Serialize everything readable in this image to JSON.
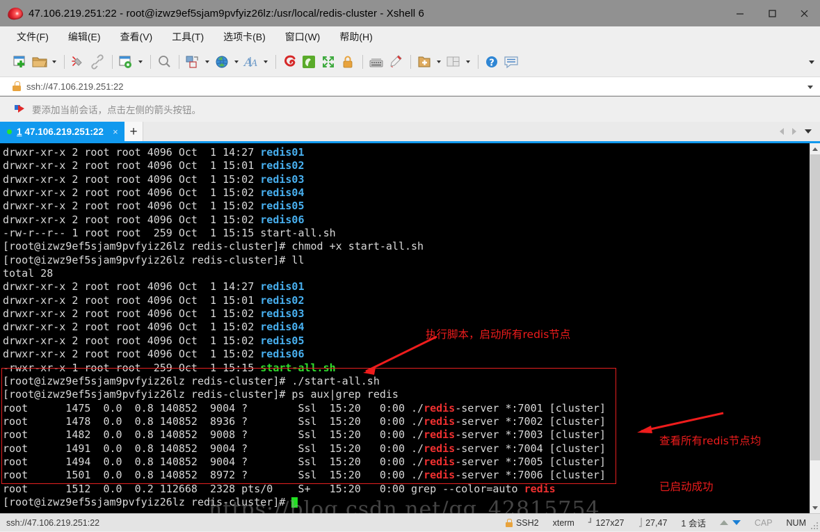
{
  "window": {
    "title": "47.106.219.251:22 - root@izwz9ef5sjam9pvfyiz26lz:/usr/local/redis-cluster - Xshell 6",
    "app_icon": "xshell-shell-icon",
    "minimize": "—",
    "maximize": "□",
    "close": "✕"
  },
  "menubar": {
    "items": [
      {
        "label": "文件(F)",
        "name": "menu-file"
      },
      {
        "label": "编辑(E)",
        "name": "menu-edit"
      },
      {
        "label": "查看(V)",
        "name": "menu-view"
      },
      {
        "label": "工具(T)",
        "name": "menu-tools"
      },
      {
        "label": "选项卡(B)",
        "name": "menu-tabs"
      },
      {
        "label": "窗口(W)",
        "name": "menu-window"
      },
      {
        "label": "帮助(H)",
        "name": "menu-help"
      }
    ]
  },
  "toolbar": {
    "icons": [
      "new-session-icon",
      "open-folder-icon",
      "disconnect-icon",
      "link-icon",
      "session-properties-icon",
      "find-icon",
      "file-transfer-icon",
      "web-transfer-icon",
      "font-icon",
      "xshell-icon",
      "xftp-icon",
      "fullscreen-icon",
      "lock-icon",
      "keyboard-icon",
      "highlight-icon",
      "new-folder-icon",
      "layout-icon",
      "help-icon",
      "feedback-icon"
    ],
    "overflow": "toolbar-overflow-icon"
  },
  "address_bar": {
    "lock_icon": "lock-icon",
    "url": "ssh://47.106.219.251:22",
    "dropdown_icon": "chevron-down-icon"
  },
  "notice": {
    "icon": "red-flag-icon",
    "text": "要添加当前会话，点击左侧的箭头按钮。"
  },
  "tabs": {
    "active": {
      "status_dot": "connected",
      "index": "1",
      "label": "47.106.219.251:22",
      "close_icon": "×"
    },
    "new_tab_label": "+",
    "scroll_left_icon": "chevron-left-icon",
    "scroll_right_icon": "chevron-right-icon",
    "tab_menu_icon": "chevron-down-icon"
  },
  "terminal": {
    "lines": [
      [
        {
          "t": "drwxr-xr-x 2 root root 4096 Oct  1 14:27 ",
          "c": "w"
        },
        {
          "t": "redis01",
          "c": "b"
        }
      ],
      [
        {
          "t": "drwxr-xr-x 2 root root 4096 Oct  1 15:01 ",
          "c": "w"
        },
        {
          "t": "redis02",
          "c": "b"
        }
      ],
      [
        {
          "t": "drwxr-xr-x 2 root root 4096 Oct  1 15:02 ",
          "c": "w"
        },
        {
          "t": "redis03",
          "c": "b"
        }
      ],
      [
        {
          "t": "drwxr-xr-x 2 root root 4096 Oct  1 15:02 ",
          "c": "w"
        },
        {
          "t": "redis04",
          "c": "b"
        }
      ],
      [
        {
          "t": "drwxr-xr-x 2 root root 4096 Oct  1 15:02 ",
          "c": "w"
        },
        {
          "t": "redis05",
          "c": "b"
        }
      ],
      [
        {
          "t": "drwxr-xr-x 2 root root 4096 Oct  1 15:02 ",
          "c": "w"
        },
        {
          "t": "redis06",
          "c": "b"
        }
      ],
      [
        {
          "t": "-rw-r--r-- 1 root root  259 Oct  1 15:15 start-all.sh",
          "c": "w"
        }
      ],
      [
        {
          "t": "[root@izwz9ef5sjam9pvfyiz26lz redis-cluster]# chmod +x start-all.sh",
          "c": "w"
        }
      ],
      [
        {
          "t": "[root@izwz9ef5sjam9pvfyiz26lz redis-cluster]# ll",
          "c": "w"
        }
      ],
      [
        {
          "t": "total 28",
          "c": "w"
        }
      ],
      [
        {
          "t": "drwxr-xr-x 2 root root 4096 Oct  1 14:27 ",
          "c": "w"
        },
        {
          "t": "redis01",
          "c": "b"
        }
      ],
      [
        {
          "t": "drwxr-xr-x 2 root root 4096 Oct  1 15:01 ",
          "c": "w"
        },
        {
          "t": "redis02",
          "c": "b"
        }
      ],
      [
        {
          "t": "drwxr-xr-x 2 root root 4096 Oct  1 15:02 ",
          "c": "w"
        },
        {
          "t": "redis03",
          "c": "b"
        }
      ],
      [
        {
          "t": "drwxr-xr-x 2 root root 4096 Oct  1 15:02 ",
          "c": "w"
        },
        {
          "t": "redis04",
          "c": "b"
        }
      ],
      [
        {
          "t": "drwxr-xr-x 2 root root 4096 Oct  1 15:02 ",
          "c": "w"
        },
        {
          "t": "redis05",
          "c": "b"
        }
      ],
      [
        {
          "t": "drwxr-xr-x 2 root root 4096 Oct  1 15:02 ",
          "c": "w"
        },
        {
          "t": "redis06",
          "c": "b"
        }
      ],
      [
        {
          "t": "-rwxr-xr-x 1 root root  259 Oct  1 15:15 ",
          "c": "w"
        },
        {
          "t": "start-all.sh",
          "c": "g"
        }
      ],
      [
        {
          "t": "[root@izwz9ef5sjam9pvfyiz26lz redis-cluster]# ./start-all.sh",
          "c": "w"
        }
      ],
      [
        {
          "t": "[root@izwz9ef5sjam9pvfyiz26lz redis-cluster]# ps aux|grep redis",
          "c": "w"
        }
      ],
      [
        {
          "t": "root      1475  0.0  0.8 140852  9004 ?        Ssl  15:20   0:00 ./",
          "c": "w"
        },
        {
          "t": "redis",
          "c": "r"
        },
        {
          "t": "-server *:7001 [cluster]",
          "c": "w"
        }
      ],
      [
        {
          "t": "root      1478  0.0  0.8 140852  8936 ?        Ssl  15:20   0:00 ./",
          "c": "w"
        },
        {
          "t": "redis",
          "c": "r"
        },
        {
          "t": "-server *:7002 [cluster]",
          "c": "w"
        }
      ],
      [
        {
          "t": "root      1482  0.0  0.8 140852  9008 ?        Ssl  15:20   0:00 ./",
          "c": "w"
        },
        {
          "t": "redis",
          "c": "r"
        },
        {
          "t": "-server *:7003 [cluster]",
          "c": "w"
        }
      ],
      [
        {
          "t": "root      1491  0.0  0.8 140852  9004 ?        Ssl  15:20   0:00 ./",
          "c": "w"
        },
        {
          "t": "redis",
          "c": "r"
        },
        {
          "t": "-server *:7004 [cluster]",
          "c": "w"
        }
      ],
      [
        {
          "t": "root      1494  0.0  0.8 140852  9004 ?        Ssl  15:20   0:00 ./",
          "c": "w"
        },
        {
          "t": "redis",
          "c": "r"
        },
        {
          "t": "-server *:7005 [cluster]",
          "c": "w"
        }
      ],
      [
        {
          "t": "root      1501  0.0  0.8 140852  8972 ?        Ssl  15:20   0:00 ./",
          "c": "w"
        },
        {
          "t": "redis",
          "c": "r"
        },
        {
          "t": "-server *:7006 [cluster]",
          "c": "w"
        }
      ],
      [
        {
          "t": "root      1512  0.0  0.2 112668  2328 pts/0    S+   15:20   0:00 grep --color=auto ",
          "c": "w"
        },
        {
          "t": "redis",
          "c": "r"
        }
      ],
      [
        {
          "t": "[root@izwz9ef5sjam9pvfyiz26lz redis-cluster]# ",
          "c": "w"
        },
        {
          "cursor": true
        }
      ]
    ],
    "scrollbar": {
      "up_icon": "chevron-up-icon",
      "down_icon": "chevron-down-icon"
    }
  },
  "annotations": {
    "accent_color": "#ee1c1c",
    "note1": "执行脚本，启动所有redis节点",
    "note2_line1": "查看所有redis节点均",
    "note2_line2": "已启动成功"
  },
  "watermark": {
    "text": "https://blog.csdn.net/qq_42815754"
  },
  "statusbar": {
    "left": "ssh://47.106.219.251:22",
    "security": "SSH2",
    "term_type": "xterm",
    "size": "127x27",
    "cursor_pos": "27,47",
    "sessions": "1 会话",
    "cap": "CAP",
    "num": "NUM",
    "lock_icon": "lock-icon",
    "size_icon": "terminal-size-icon",
    "cursor_icon": "cursor-pos-icon",
    "upload_icon": "upload-arrow-icon",
    "download_icon": "download-arrow-icon"
  }
}
